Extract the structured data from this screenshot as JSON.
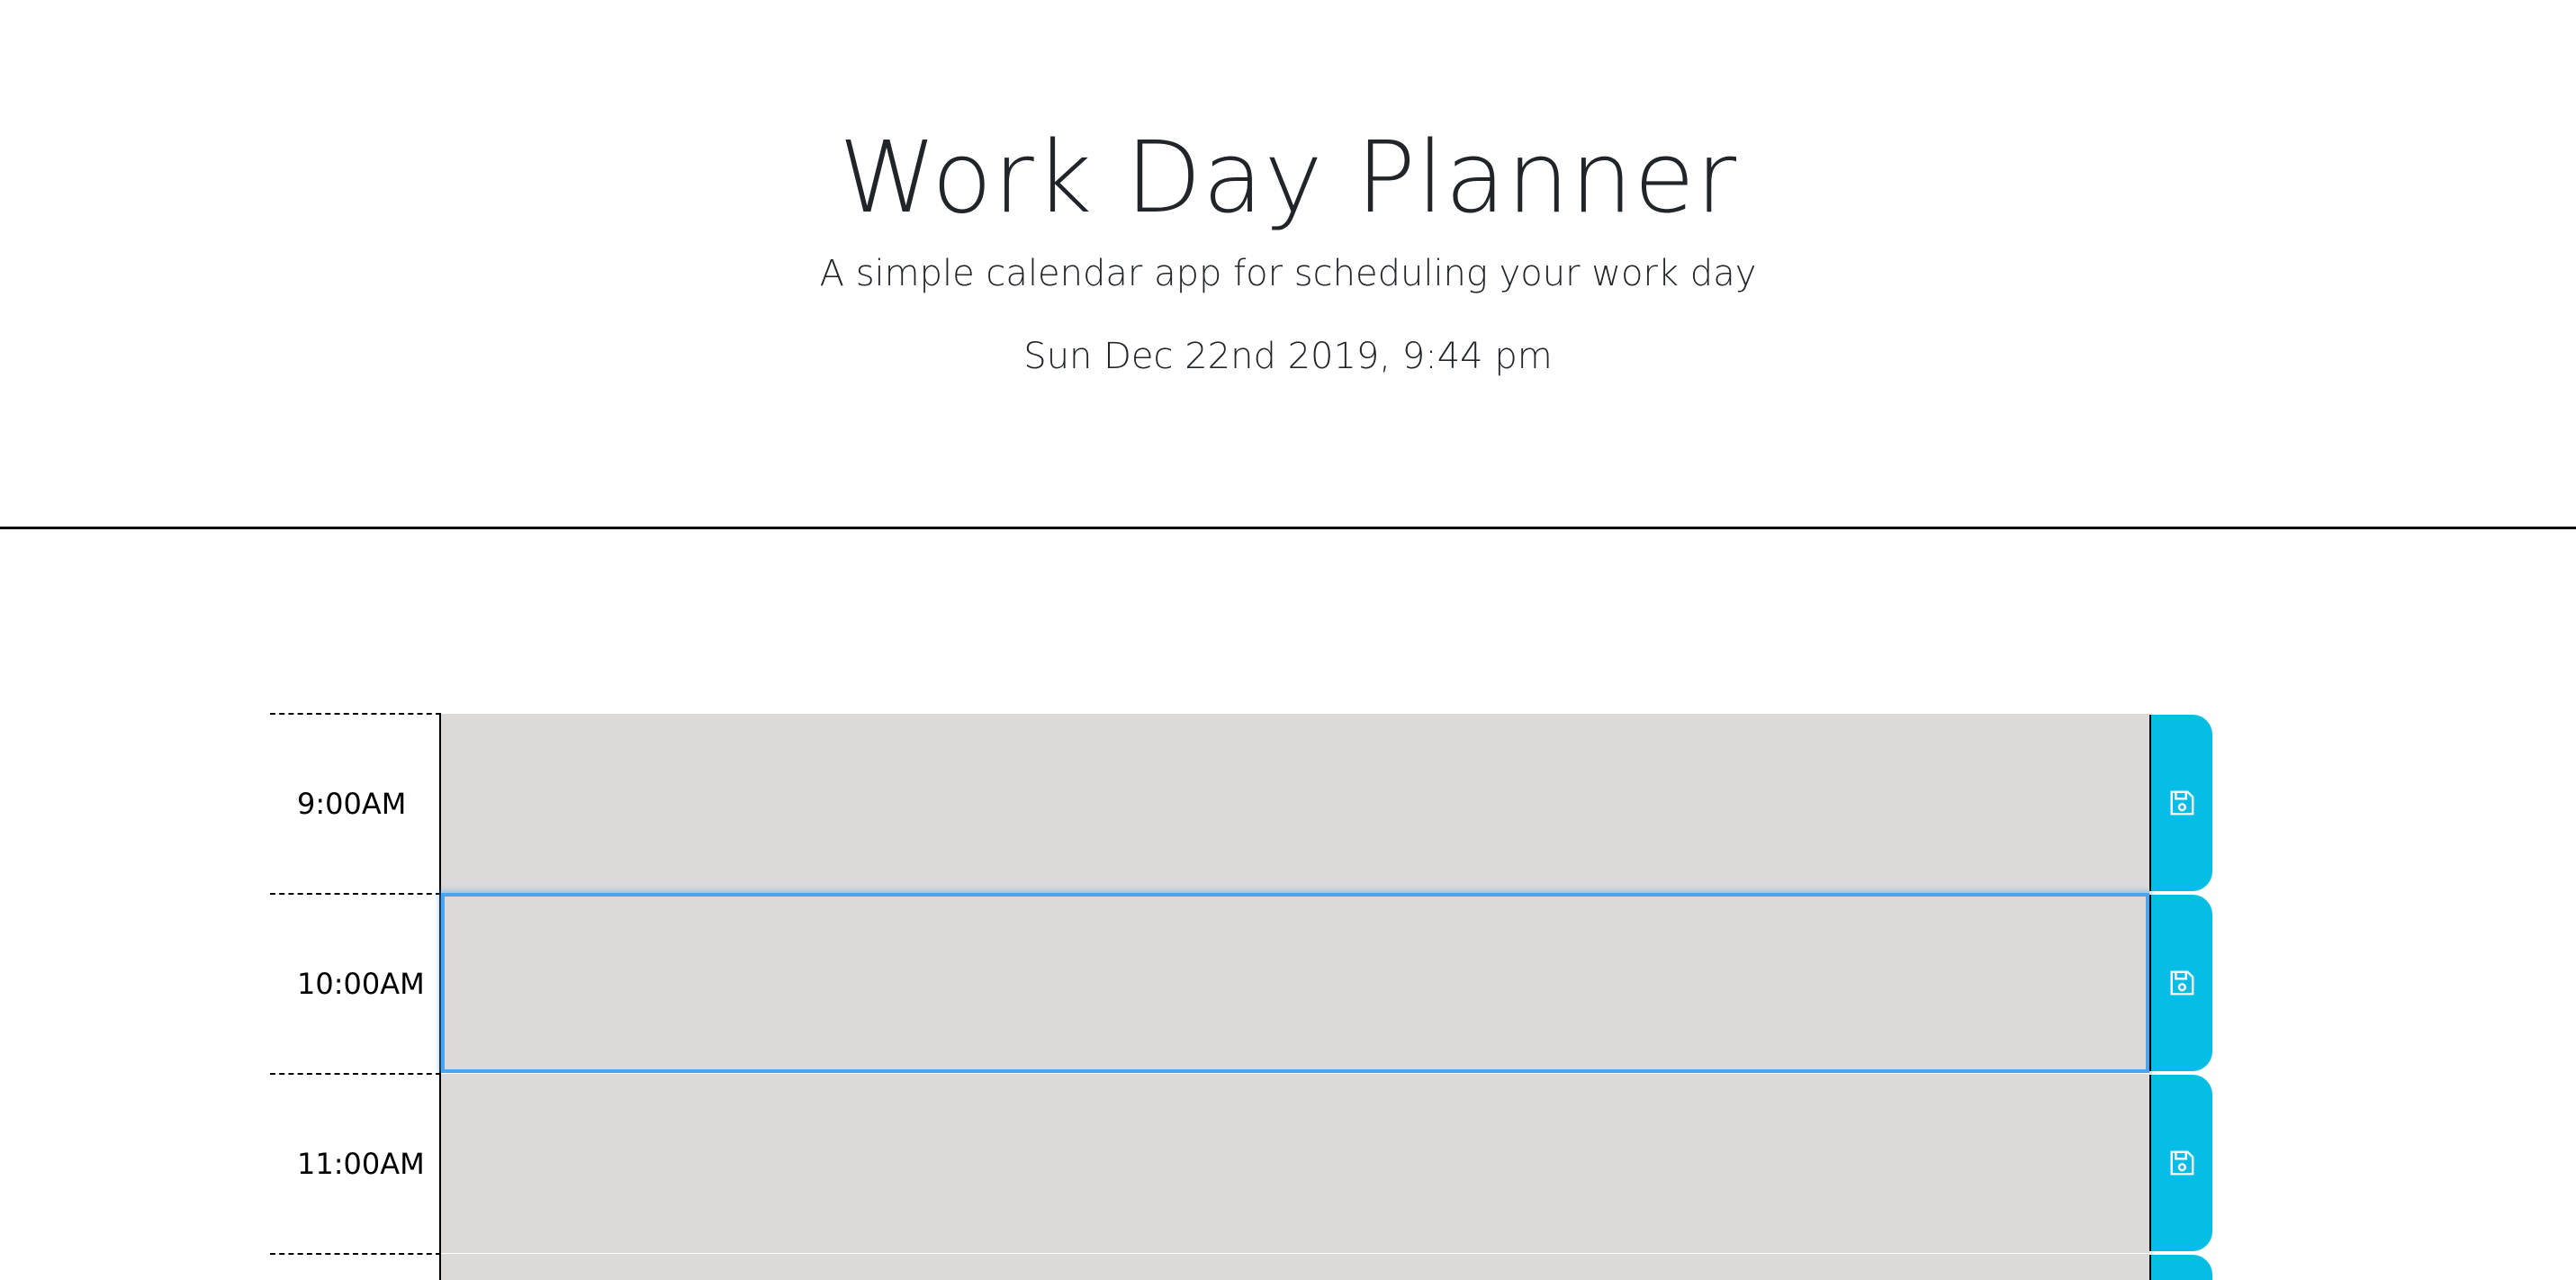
{
  "header": {
    "title": "Work Day Planner",
    "lead": "A simple calendar app for scheduling your work day",
    "current_day": "Sun Dec 22nd 2019, 9:44 pm"
  },
  "time_blocks": [
    {
      "hour": "9:00AM",
      "description": "",
      "save_icon": "floppy-disk-icon"
    },
    {
      "hour": "10:00AM",
      "description": "",
      "save_icon": "floppy-disk-icon"
    },
    {
      "hour": "11:00AM",
      "description": "",
      "save_icon": "floppy-disk-icon"
    },
    {
      "hour": "",
      "description": "",
      "save_icon": "floppy-disk-icon"
    }
  ],
  "colors": {
    "past_block": "#dcd9d9",
    "save_button": "#06bde6",
    "focus_ring": "#4aa5ee",
    "text": "#212529"
  }
}
